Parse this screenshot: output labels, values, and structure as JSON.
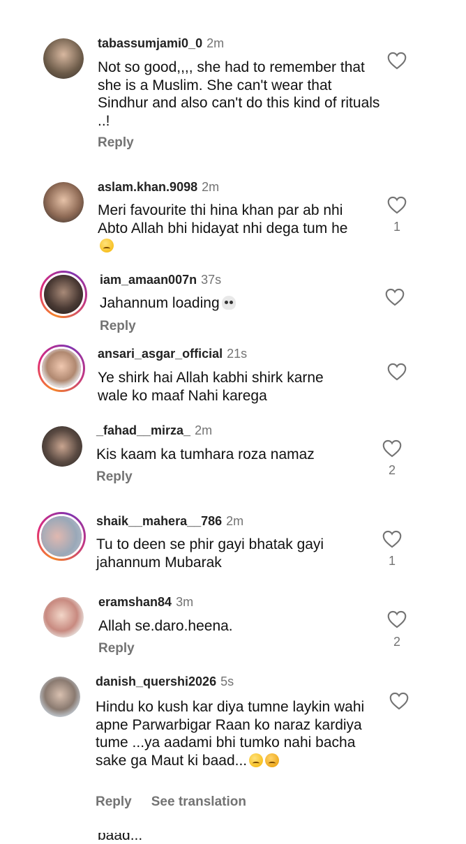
{
  "comments": [
    {
      "user": "tabassumjami0_0",
      "time": "2m",
      "text": "Not so good,,,, she had to remember that she is a Muslim. She can't wear that Sindhur and also can't do this kind of rituals ..!",
      "reply": "Reply",
      "likes": ""
    },
    {
      "user": "aslam.khan.9098",
      "time": "2m",
      "text": "Meri favourite thi hina khan par ab nhi Abto Allah bhi hidayat nhi dega tum he",
      "emoji": "pensive-face",
      "reply": "",
      "likes": "1"
    },
    {
      "user": "iam_amaan007n",
      "time": "37s",
      "text": "Jahannum loading",
      "emoji": "skull",
      "reply": "Reply",
      "likes": ""
    },
    {
      "user": "ansari_asgar_official",
      "time": "21s",
      "text": "Ye shirk hai Allah kabhi shirk karne wale ko maaf Nahi karega",
      "reply": "",
      "likes": ""
    },
    {
      "user": "_fahad__mirza_",
      "time": "2m",
      "text": "Kis kaam ka tumhara roza namaz",
      "reply": "Reply",
      "likes": "2"
    },
    {
      "user": "shaik__mahera__786",
      "time": "2m",
      "text": "Tu to deen se phir gayi bhatak gayi jahannum Mubarak",
      "reply": "",
      "likes": "1"
    },
    {
      "user": "eramshan84",
      "time": "3m",
      "text": "Allah se.daro.heena.",
      "reply": "Reply",
      "likes": "2"
    },
    {
      "user": "danish_quershi2026",
      "time": "5s",
      "text": "Hindu ko kush kar diya tumne laykin wahi apne Parwarbigar Raan ko naraz kardiya tume ...ya  aadami bhi tumko nahi bacha sake ga Maut ki baad...",
      "emoji": "smirk-and-angry",
      "reply": "Reply",
      "see_translation": "See translation",
      "likes": ""
    }
  ],
  "cutoff_text": "baad...",
  "colors": {
    "muted": "#737373",
    "ring_start": "#f58529",
    "ring_mid": "#dd2a7b",
    "ring_end": "#8134af"
  }
}
